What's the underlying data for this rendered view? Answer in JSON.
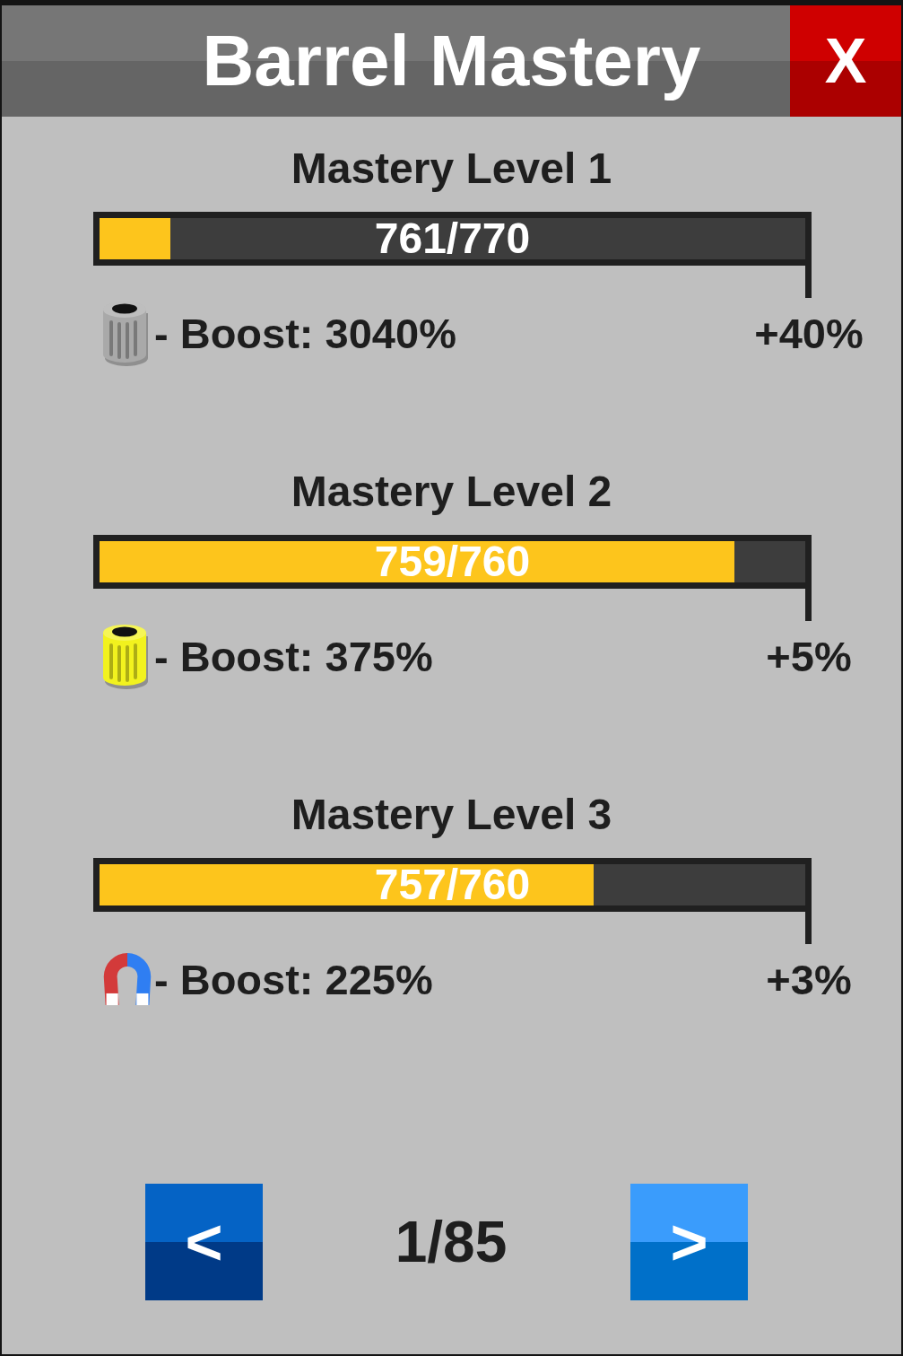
{
  "header": {
    "title": "Barrel Mastery",
    "close_label": "X"
  },
  "levels": [
    {
      "title": "Mastery Level 1",
      "progress_text": "761/770",
      "level": 0.1,
      "kind": "barrel",
      "color": "#a9a9a9",
      "boost": "- Boost: 3040%",
      "bonus": "+40%"
    },
    {
      "title": "Mastery Level 2",
      "progress_text": "759/760",
      "level": 0.9,
      "kind": "barrel",
      "color": "#f2f21e",
      "boost": "- Boost: 375%",
      "bonus": "+5%"
    },
    {
      "title": "Mastery Level 3",
      "progress_text": "757/760",
      "level": 0.7,
      "kind": "magnet",
      "boost": "- Boost: 225%",
      "bonus": "+3%"
    }
  ],
  "pagination": {
    "previous": {
      "label": "<",
      "disabled": true
    },
    "page": "1/85",
    "next": {
      "label": ">",
      "disabled": false
    }
  }
}
